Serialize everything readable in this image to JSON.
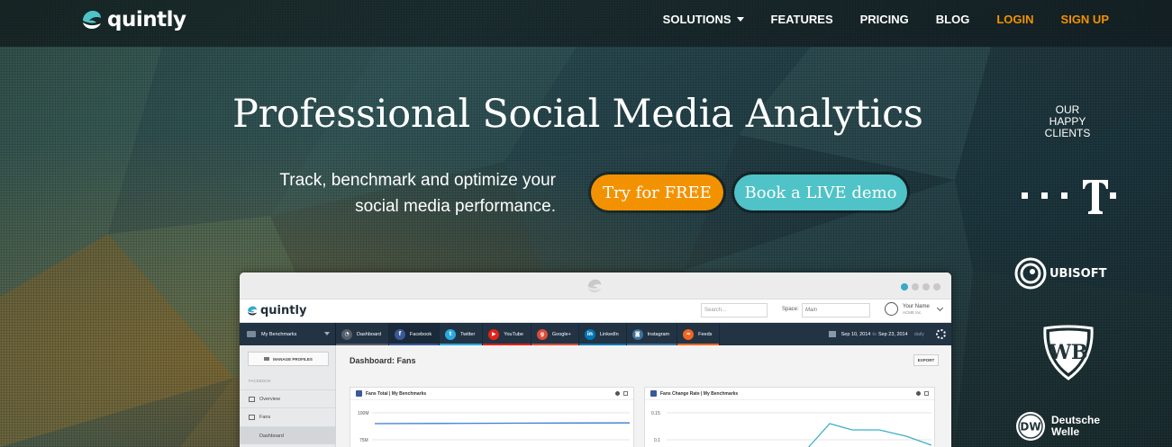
{
  "brand": {
    "name": "quintly"
  },
  "nav": {
    "items": [
      {
        "label": "SOLUTIONS",
        "dropdown": true,
        "accent": false
      },
      {
        "label": "FEATURES",
        "dropdown": false,
        "accent": false
      },
      {
        "label": "PRICING",
        "dropdown": false,
        "accent": false
      },
      {
        "label": "BLOG",
        "dropdown": false,
        "accent": false
      },
      {
        "label": "LOGIN",
        "dropdown": false,
        "accent": true
      },
      {
        "label": "SIGN UP",
        "dropdown": false,
        "accent": true
      }
    ],
    "accent_color": "#f39200"
  },
  "hero": {
    "title": "Professional Social Media Analytics",
    "subtitle_line1": "Track, benchmark and optimize your",
    "subtitle_line2": "social media performance.",
    "cta_primary": "Try for FREE",
    "cta_secondary": "Book a LIVE demo",
    "cta_primary_color": "#f39200",
    "cta_secondary_color": "#4fc3c7"
  },
  "clients": {
    "title_line1": "OUR",
    "title_line2": "HAPPY",
    "title_line3": "CLIENTS",
    "logos": [
      {
        "icon": "telekom-logo-icon",
        "text": "T"
      },
      {
        "icon": "ubisoft-logo-icon",
        "text": "UBISOFT"
      },
      {
        "icon": "warner-bros-logo-icon",
        "text": "WB"
      },
      {
        "icon": "deutsche-welle-logo-icon",
        "badge": "DW",
        "line1": "Deutsche",
        "line2": "Welle"
      }
    ]
  },
  "app": {
    "brand": "quintly",
    "search_placeholder": "Search...",
    "space_label": "Space:",
    "space_value": "Main",
    "user_name": "Your Name",
    "user_org": "ACME Inc.",
    "benchmark": "My Benchmarks",
    "tabs": [
      {
        "label": "Dashboard",
        "color": "#555f69",
        "glyph": "◔",
        "active": false
      },
      {
        "label": "Facebook",
        "color": "#3b5998",
        "glyph": "f",
        "active": true
      },
      {
        "label": "Twitter",
        "color": "#2aa9e0",
        "glyph": "t",
        "active": false
      },
      {
        "label": "YouTube",
        "color": "#e62117",
        "glyph": "▶",
        "active": false
      },
      {
        "label": "Google+",
        "color": "#dd4b39",
        "glyph": "g",
        "active": false
      },
      {
        "label": "LinkedIn",
        "color": "#0077b5",
        "glyph": "in",
        "active": false
      },
      {
        "label": "Instagram",
        "color": "#3f729b",
        "glyph": "◙",
        "active": false
      },
      {
        "label": "Feeds",
        "color": "#f26522",
        "glyph": "≈",
        "active": false
      }
    ],
    "date_from": "Sep 10, 2014",
    "date_to_word": "to",
    "date_to": "Sep 23, 2014",
    "interval": "daily",
    "manage_profiles": "MANAGE PROFILES",
    "sidebar_section": "FACEBOOK",
    "sidebar_items": [
      {
        "label": "Overview",
        "active": false
      },
      {
        "label": "Fans",
        "active": false
      },
      {
        "label": "Dashboard",
        "active": true
      }
    ],
    "page_title": "Dashboard: Fans",
    "export": "EXPORT",
    "widgets": [
      {
        "title": "Fans Total | My Benchmarks",
        "y_ticks": [
          "100M",
          "75M"
        ]
      },
      {
        "title": "Fans Change Rate | My Benchmarks",
        "y_ticks": [
          "0.15",
          "0.1"
        ]
      }
    ]
  }
}
